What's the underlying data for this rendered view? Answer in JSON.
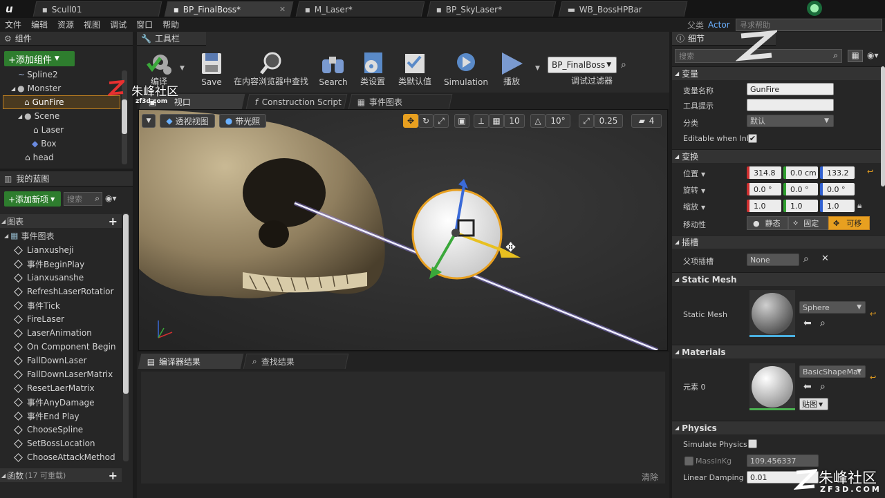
{
  "window": {
    "tabs": [
      {
        "label": "Scull01"
      },
      {
        "label": "BP_FinalBoss*"
      },
      {
        "label": "M_Laser*"
      },
      {
        "label": "BP_SkyLaser*"
      },
      {
        "label": "WB_BossHPBar"
      }
    ],
    "parent_class_label": "父类",
    "parent_class_value": "Actor",
    "help_search_placeholder": "寻求帮助"
  },
  "menu": [
    "文件",
    "编辑",
    "资源",
    "视图",
    "调试",
    "窗口",
    "帮助"
  ],
  "components": {
    "tab_label": "组件",
    "add_button": "+添加组件",
    "items": [
      "Spline2",
      "Monster",
      "GunFire",
      "Scene",
      "Laser",
      "Box",
      "head"
    ]
  },
  "my_blueprint": {
    "tab_label": "我的蓝图",
    "add_button": "+添加新项",
    "search_placeholder": "搜索",
    "graphs_label": "图表",
    "event_graph_label": "事件图表",
    "events": [
      "Lianxusheji",
      "事件BeginPlay",
      "Lianxusanshe",
      "RefreshLaserRotatior",
      "事件Tick",
      "FireLaser",
      "LaserAnimation",
      "On Component Begin",
      "FallDownLaser",
      "FallDownLaserMatrix",
      "ResetLaerMatrix",
      "事件AnyDamage",
      "事件End Play",
      "ChooseSpline",
      "SetBossLocation",
      "ChooseAttackMethod"
    ],
    "functions_label": "函数",
    "functions_count": "(17 可重载)"
  },
  "toolbar": {
    "tab_label": "工具栏",
    "compile_label": "编译",
    "save_label": "Save",
    "browse_label": "在内容浏览器中查找",
    "search_label": "Search",
    "class_settings_label": "类设置",
    "class_defaults_label": "类默认值",
    "simulation_label": "Simulation",
    "play_label": "播放",
    "debug_object": "BP_FinalBoss",
    "debug_filter_label": "调试过滤器"
  },
  "editor_tabs": {
    "viewport_label": "视口",
    "construction_label": "Construction Script",
    "event_graph_label": "事件图表"
  },
  "viewport": {
    "perspective_label": "透视视图",
    "lit_label": "带光照",
    "grid_snap": "10",
    "rot_snap": "10°",
    "scale_snap": "0.25",
    "cam_speed": "4"
  },
  "bottom_tabs": {
    "compiler_results": "编译器结果",
    "find_results": "查找结果",
    "clear_label": "清除"
  },
  "details": {
    "tab_label": "细节",
    "search_placeholder": "搜索",
    "variable_section": "变量",
    "var_name_label": "变量名称",
    "var_name_value": "GunFire",
    "tooltip_label": "工具提示",
    "tooltip_value": "",
    "category_label": "分类",
    "category_value": "默认",
    "editable_label": "Editable when Inh",
    "editable_checked": "✔",
    "transform_section": "变换",
    "location_label": "位置",
    "location": [
      "314.8",
      "0.0 cm",
      "133.2"
    ],
    "rotation_label": "旋转",
    "rotation": [
      "0.0 °",
      "0.0 °",
      "0.0 °"
    ],
    "scale_label": "缩放",
    "scale": [
      "1.0",
      "1.0",
      "1.0"
    ],
    "mobility_label": "移动性",
    "mobility_static": "静态",
    "mobility_stationary": "固定",
    "mobility_movable": "可移",
    "socket_section": "插槽",
    "parent_socket_label": "父项插槽",
    "parent_socket_value": "None",
    "static_mesh_section": "Static Mesh",
    "static_mesh_label": "Static Mesh",
    "static_mesh_value": "Sphere",
    "materials_section": "Materials",
    "element_label": "元素 0",
    "material_value": "BasicShapeMat",
    "texture_label": "贴图",
    "physics_section": "Physics",
    "simulate_physics_label": "Simulate Physics",
    "mass_label": "MassInKg",
    "mass_value": "109.456337",
    "linear_damping_label": "Linear Damping",
    "linear_damping_value": "0.01"
  },
  "watermark": {
    "brand": "朱峰社区",
    "site_small": "zf3d.com",
    "site": "ZF3D.COM"
  },
  "colors": {
    "accent_orange": "#e8a020",
    "add_green": "#2e7d2e",
    "selected_row": "#4a3a20"
  }
}
